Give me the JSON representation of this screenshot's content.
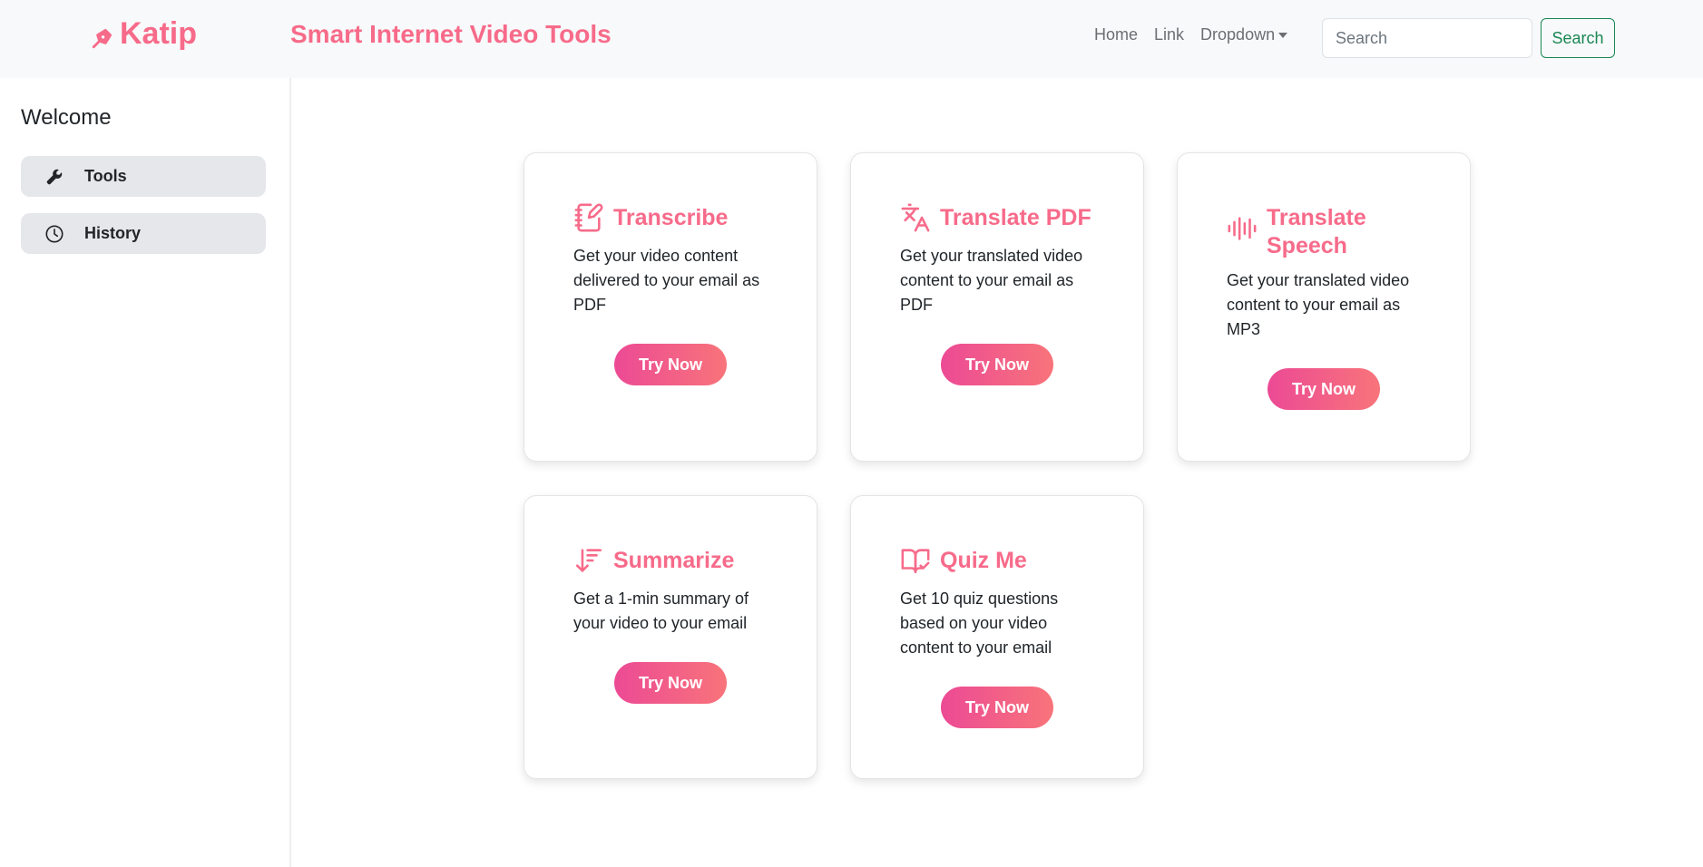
{
  "navbar": {
    "brand": "Katip",
    "title": "Smart Internet Video Tools",
    "links": {
      "home": "Home",
      "link": "Link",
      "dropdown": "Dropdown"
    },
    "search": {
      "placeholder": "Search",
      "button": "Search"
    }
  },
  "sidebar": {
    "heading": "Welcome",
    "items": [
      {
        "label": "Tools",
        "icon": "wrench-icon"
      },
      {
        "label": "History",
        "icon": "clock-icon"
      }
    ]
  },
  "cards": [
    {
      "title": "Transcribe",
      "icon": "notebook-pen-icon",
      "description": "Get your video content delivered to your email as PDF",
      "button": "Try Now"
    },
    {
      "title": "Translate PDF",
      "icon": "translate-icon",
      "description": "Get your translated video content to your email as PDF",
      "button": "Try Now"
    },
    {
      "title": "Translate Speech",
      "icon": "audio-waveform-icon",
      "description": "Get your translated video content to your email as MP3",
      "button": "Try Now"
    },
    {
      "title": "Summarize",
      "icon": "sort-descending-icon",
      "description": "Get a 1-min summary of your video to your email",
      "button": "Try Now"
    },
    {
      "title": "Quiz Me",
      "icon": "book-check-icon",
      "description": "Get 10 quiz questions based on your video content to your email",
      "button": "Try Now"
    }
  ],
  "colors": {
    "accent": "#f76b8a",
    "gradient_start": "#ec4a95",
    "gradient_end": "#f8747a",
    "search_button": "#198754",
    "sidebar_item_bg": "#e6e7ea"
  }
}
